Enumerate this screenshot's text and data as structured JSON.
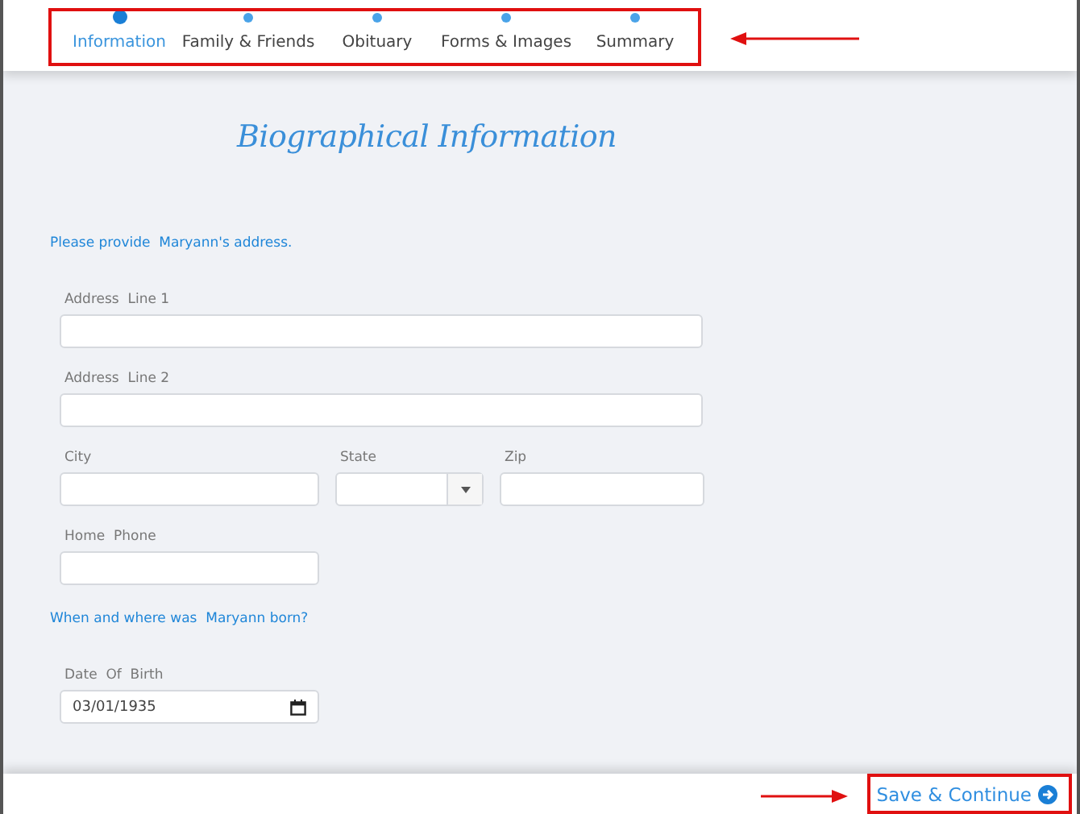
{
  "tabs": [
    {
      "label": "Information",
      "selected": true
    },
    {
      "label": "Family & Friends",
      "selected": false
    },
    {
      "label": "Obituary",
      "selected": false
    },
    {
      "label": "Forms & Images",
      "selected": false
    },
    {
      "label": "Summary",
      "selected": false
    }
  ],
  "heading": "Biographical Information",
  "sections": [
    {
      "question": "Please provide  Maryann's address.",
      "rows": [
        [
          {
            "label": "Address  Line 1",
            "kind": "text"
          }
        ],
        [
          {
            "label": "Address  Line 2",
            "kind": "text"
          }
        ],
        [
          {
            "label": "City",
            "kind": "text"
          },
          {
            "label": "State",
            "kind": "select"
          },
          {
            "label": "Zip",
            "kind": "text"
          }
        ],
        [
          {
            "label": "Home  Phone",
            "kind": "text"
          }
        ]
      ]
    },
    {
      "question": "When and where was  Maryann born?",
      "rows": [
        [
          {
            "label": "Date  Of  Birth",
            "kind": "date",
            "value": "03/01/1935"
          }
        ]
      ]
    }
  ],
  "footer": {
    "button": "Save & Continue"
  }
}
